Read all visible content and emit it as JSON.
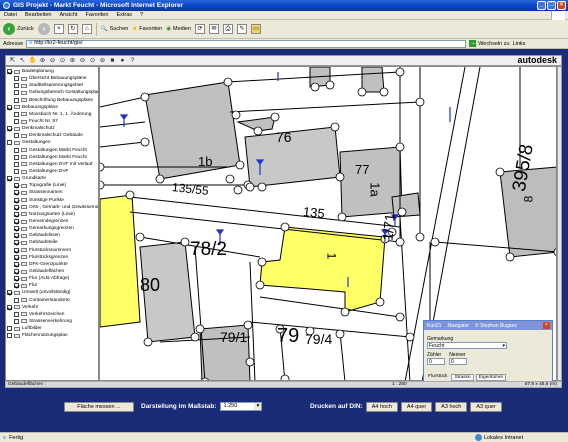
{
  "window": {
    "title": "GIS Projekt - Markt Feucht - Microsoft Internet Explorer"
  },
  "menu": [
    "Datei",
    "Bearbeiten",
    "Ansicht",
    "Favoriten",
    "Extras",
    "?"
  ],
  "toolbar": {
    "back": "Zurück",
    "search": "Suchen",
    "favorites": "Favoriten",
    "media": "Medien"
  },
  "address": {
    "label": "Adresse",
    "url": "http://kr2-feucht/gis/",
    "go": "Wechseln zu",
    "links": "Links"
  },
  "brand": "autodesk",
  "gis_tools": [
    "⇱",
    "↖",
    "✋",
    "⊕",
    "⊖",
    "⊙",
    "⊕",
    "⊖",
    "⊙",
    "⊚",
    "■",
    "●",
    "?"
  ],
  "layers": [
    {
      "label": "Bauleitplanung",
      "checked": true,
      "group": true
    },
    {
      "label": "Übersicht Bebauungspläne",
      "checked": false,
      "group": false
    },
    {
      "label": "Stadtteilsanierungsgebiet",
      "checked": false,
      "group": false
    },
    {
      "label": "Geltungsbereich Gestaltungsplan",
      "checked": false,
      "group": false
    },
    {
      "label": "Beschriftung Bebauungspläne",
      "checked": false,
      "group": false
    },
    {
      "label": "Bebauungspläne",
      "checked": true,
      "group": true
    },
    {
      "label": "Moosbach Nr. 1, 1. Änderung",
      "checked": false,
      "group": false
    },
    {
      "label": "Feucht Nr. 57",
      "checked": false,
      "group": false
    },
    {
      "label": "Denkmalschutz",
      "checked": true,
      "group": true
    },
    {
      "label": "Denkmalschutz Gebäude",
      "checked": false,
      "group": false
    },
    {
      "label": "Gestaltungen",
      "checked": false,
      "group": true
    },
    {
      "label": "Gestaltungen Markt Feucht",
      "checked": false,
      "group": false
    },
    {
      "label": "Gestaltungen Markt Feucht",
      "checked": false,
      "group": false
    },
    {
      "label": "Gestaltungen DVF mit Verlauf",
      "checked": false,
      "group": false
    },
    {
      "label": "Gestaltungen DVF",
      "checked": false,
      "group": false
    },
    {
      "label": "Grundkarte",
      "checked": true,
      "group": true
    },
    {
      "label": "Topografie (Linie)",
      "checked": true,
      "group": false
    },
    {
      "label": "Strassennamen",
      "checked": true,
      "group": false
    },
    {
      "label": "Sonstige Punkte",
      "checked": true,
      "group": false
    },
    {
      "label": "Orts-, Gemark- und Gewässernamen",
      "checked": true,
      "group": false
    },
    {
      "label": "Nutzungsarten (Linie)",
      "checked": true,
      "group": false
    },
    {
      "label": "Gemeindegrenzen",
      "checked": true,
      "group": false
    },
    {
      "label": "Gemarkungsgrenzen",
      "checked": true,
      "group": false
    },
    {
      "label": "Gebäudelinien",
      "checked": true,
      "group": false
    },
    {
      "label": "Gebäudeteile",
      "checked": true,
      "group": false
    },
    {
      "label": "Flurstücksnummern",
      "checked": true,
      "group": false
    },
    {
      "label": "Flurstücksgrenzen",
      "checked": true,
      "group": false
    },
    {
      "label": "DFK-Grenzpunkte",
      "checked": true,
      "group": false
    },
    {
      "label": "Gebäudeflächen",
      "checked": true,
      "group": false
    },
    {
      "label": "Flur (ALB-Abfrage)",
      "checked": true,
      "group": false
    },
    {
      "label": "Flur",
      "checked": true,
      "group": false
    },
    {
      "label": "Umwelt (unvollständig)",
      "checked": true,
      "group": true
    },
    {
      "label": "Containerstandorte",
      "checked": false,
      "group": false
    },
    {
      "label": "Verkehr",
      "checked": true,
      "group": true
    },
    {
      "label": "Verkehrszeichen",
      "checked": false,
      "group": false
    },
    {
      "label": "Strassenverkehrung",
      "checked": false,
      "group": false
    },
    {
      "label": "Luftbilder",
      "checked": false,
      "group": true
    },
    {
      "label": "Flächennutzungsplan",
      "checked": false,
      "group": true
    }
  ],
  "parcel_labels": [
    "76",
    "77",
    "1b",
    "1a",
    "135/55",
    "135",
    "395/8",
    "8",
    "1/71",
    "78/2",
    "1",
    "80",
    "79/1",
    "79",
    "79/4"
  ],
  "status": {
    "left": "Gebäudeflächen :",
    "scale": "1 : 250",
    "coords": "67,9 x 46,6 (m)"
  },
  "bottom": {
    "area_button": "Fläche messen ...",
    "scale_label": "Darstellung im Maßstab:",
    "scale_value": "1:250",
    "print_label": "Drucken auf DIN:",
    "print_buttons": [
      "A4 hoch",
      "A4 quer",
      "A3 hoch",
      "A3 quer"
    ]
  },
  "float_window": {
    "tabs": [
      "Kun21",
      "Navigator",
      "© Stephan Buganz"
    ],
    "field_gemarkung": "Gemarkung",
    "gemarkung_value": "Feucht",
    "zaehler": "Zähler",
    "nenner": "Nenner",
    "zaehler_value": "0",
    "nenner_value": "0",
    "footer_tabs": [
      "Flurstück",
      "Strasse",
      "Eigentümer"
    ]
  },
  "statusbar": {
    "left": "Fertig",
    "zone": "Lokales Intranet"
  }
}
